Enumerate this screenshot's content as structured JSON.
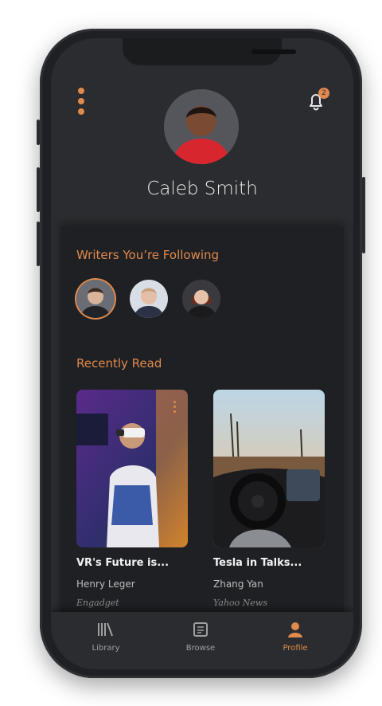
{
  "profile": {
    "name": "Caleb Smith",
    "notification_count": "2"
  },
  "sections": {
    "following_title": "Writers You’re Following",
    "recent_title": "Recently Read"
  },
  "writers": [
    {
      "name": "writer-1",
      "selected": true
    },
    {
      "name": "writer-2",
      "selected": false
    },
    {
      "name": "writer-3",
      "selected": false
    }
  ],
  "recent": [
    {
      "title": "VR's Future is...",
      "author": "Henry Leger",
      "source": "Engadget"
    },
    {
      "title": "Tesla in Talks...",
      "author": "Zhang Yan",
      "source": "Yahoo News"
    }
  ],
  "tabs": [
    {
      "label": "Library",
      "icon": "library-icon",
      "active": false
    },
    {
      "label": "Browse",
      "icon": "news-icon",
      "active": false
    },
    {
      "label": "Profile",
      "icon": "person-icon",
      "active": true
    }
  ],
  "colors": {
    "accent": "#e08a4d",
    "background": "#1f2023",
    "surface": "#2b2c2f"
  }
}
